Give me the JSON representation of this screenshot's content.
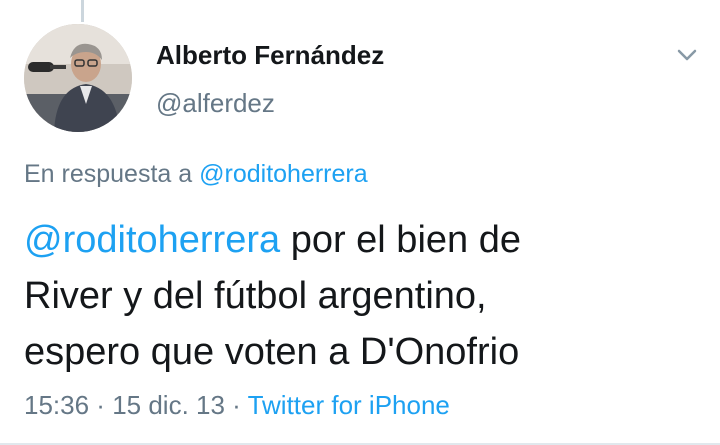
{
  "author": {
    "display_name": "Alberto Fernández",
    "handle": "@alferdez"
  },
  "reply_context": {
    "prefix": "En respuesta a",
    "handle": "@roditoherrera"
  },
  "tweet": {
    "mention": "@roditoherrera",
    "line1_rest": " por el bien de",
    "line2": "River y del fútbol argentino,",
    "line3": "espero que voten a D'Onofrio"
  },
  "meta": {
    "time": "15:36",
    "sep1": " · ",
    "date": "15 dic. 13",
    "sep2": " · ",
    "source": "Twitter for iPhone"
  },
  "icons": {
    "menu": "chevron-down-icon",
    "avatar": "profile-photo"
  },
  "colors": {
    "link": "#1da1f2",
    "secondary_text": "#657786",
    "primary_text": "#14171a"
  }
}
